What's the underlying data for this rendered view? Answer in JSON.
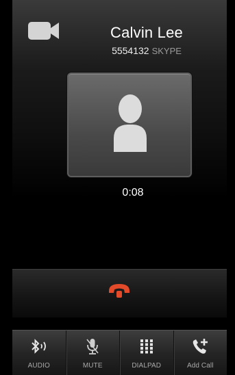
{
  "call": {
    "name": "Calvin Lee",
    "number": "5554132",
    "service": "SKYPE",
    "duration": "0:08"
  },
  "icons": {
    "video": "video-camera-icon",
    "avatar": "person-silhouette-icon",
    "end_call": "hang-up-phone-icon"
  },
  "toolbar": {
    "items": [
      {
        "label": "AUDIO",
        "icon": "bluetooth-audio-icon"
      },
      {
        "label": "MUTE",
        "icon": "microphone-muted-icon"
      },
      {
        "label": "DIALPAD",
        "icon": "keypad-grid-icon"
      },
      {
        "label": "Add Call",
        "icon": "add-call-icon"
      }
    ]
  },
  "colors": {
    "end_call": "#e34a2a",
    "toolbar_label": "#a9a9a9",
    "service_text": "#9b9b9b"
  }
}
